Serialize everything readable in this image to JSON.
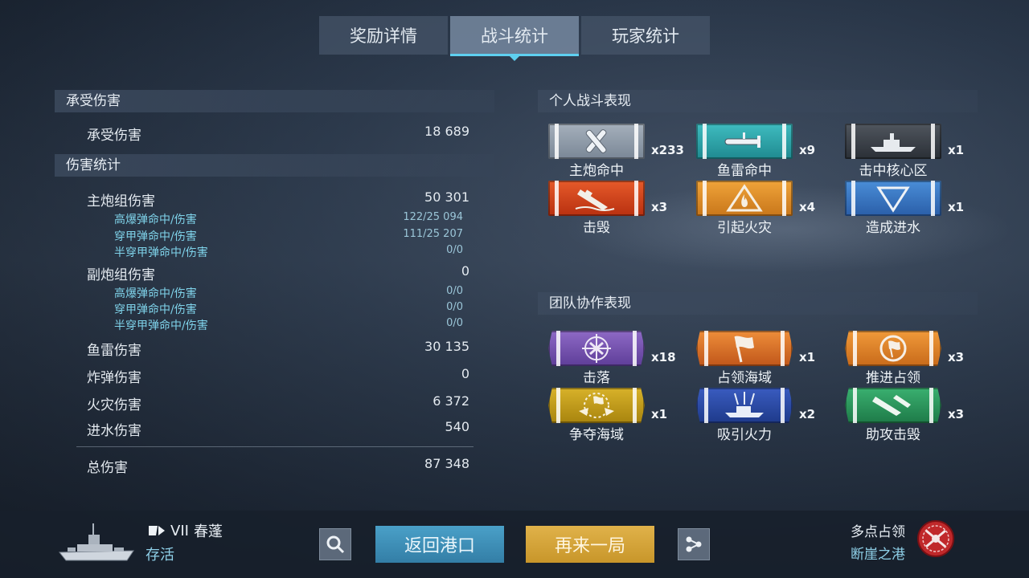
{
  "tabs": [
    {
      "label": "奖励详情"
    },
    {
      "label": "战斗统计"
    },
    {
      "label": "玩家统计"
    }
  ],
  "damage_received": {
    "header": "承受伤害",
    "label": "承受伤害",
    "value": "18 689"
  },
  "damage_stats": {
    "header": "伤害统计",
    "main_battery": {
      "label": "主炮组伤害",
      "value": "50 301"
    },
    "main_he": {
      "label": "高爆弹命中/伤害",
      "value": "122/25 094"
    },
    "main_ap": {
      "label": "穿甲弹命中/伤害",
      "value": "111/25 207"
    },
    "main_sap": {
      "label": "半穿甲弹命中/伤害",
      "value": "0/0"
    },
    "secondary": {
      "label": "副炮组伤害",
      "value": "0"
    },
    "sec_he": {
      "label": "高爆弹命中/伤害",
      "value": "0/0"
    },
    "sec_ap": {
      "label": "穿甲弹命中/伤害",
      "value": "0/0"
    },
    "sec_sap": {
      "label": "半穿甲弹命中/伤害",
      "value": "0/0"
    },
    "torpedo": {
      "label": "鱼雷伤害",
      "value": "30 135"
    },
    "bomb": {
      "label": "炸弹伤害",
      "value": "0"
    },
    "fire": {
      "label": "火灾伤害",
      "value": "6 372"
    },
    "flood": {
      "label": "进水伤害",
      "value": "540"
    },
    "total": {
      "label": "总伤害",
      "value": "87 348"
    }
  },
  "personal": {
    "header": "个人战斗表现",
    "medals": [
      {
        "label": "主炮命中",
        "count": "x233",
        "icon": "crossed-shells-icon",
        "color": "#8c98a6"
      },
      {
        "label": "鱼雷命中",
        "count": "x9",
        "icon": "torpedo-icon",
        "color": "#2aa3a8"
      },
      {
        "label": "击中核心区",
        "count": "x1",
        "icon": "citadel-ship-icon",
        "color": "#3a3f46"
      },
      {
        "label": "击毁",
        "count": "x3",
        "icon": "sinking-ship-icon",
        "color": "#d2441e"
      },
      {
        "label": "引起火灾",
        "count": "x4",
        "icon": "fire-warning-icon",
        "color": "#e08a22"
      },
      {
        "label": "造成进水",
        "count": "x1",
        "icon": "flood-triangle-icon",
        "color": "#2f74c0"
      }
    ]
  },
  "team": {
    "header": "团队协作表现",
    "medals": [
      {
        "label": "击落",
        "count": "x18",
        "icon": "crosshair-plane-icon",
        "color": "#7c5ab2"
      },
      {
        "label": "占领海域",
        "count": "x1",
        "icon": "flag-icon",
        "color": "#e07a2a"
      },
      {
        "label": "推进占领",
        "count": "x3",
        "icon": "capture-progress-icon",
        "color": "#e58a2a"
      },
      {
        "label": "争夺海域",
        "count": "x1",
        "icon": "defend-zone-icon",
        "color": "#c8a21e"
      },
      {
        "label": "吸引火力",
        "count": "x2",
        "icon": "tank-damage-icon",
        "color": "#2a4aa8"
      },
      {
        "label": "助攻击毁",
        "count": "x3",
        "icon": "assist-kill-icon",
        "color": "#2f9a5a"
      }
    ]
  },
  "bottom": {
    "tier": "VII",
    "ship_name": "春蓬",
    "status": "存活",
    "return_button": "返回港口",
    "again_button": "再来一局",
    "mode": "多点占领",
    "map": "断崖之港"
  }
}
